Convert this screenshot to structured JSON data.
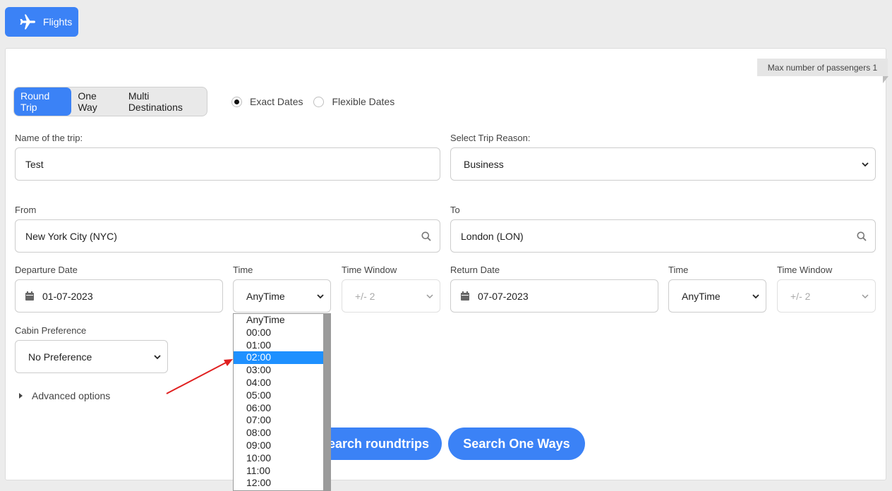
{
  "nav": {
    "flights_label": "Flights"
  },
  "badge": {
    "max_passengers": "Max number of passengers 1"
  },
  "trip_types": [
    "Round Trip",
    "One Way",
    "Multi Destinations"
  ],
  "date_modes": [
    "Exact Dates",
    "Flexible Dates"
  ],
  "form": {
    "trip_name_label": "Name of the trip:",
    "trip_name_value": "Test",
    "reason_label": "Select Trip Reason:",
    "reason_value": "Business",
    "from_label": "From",
    "from_value": "New York City (NYC)",
    "to_label": "To",
    "to_value": "London (LON)",
    "departure_label": "Departure Date",
    "departure_value": "01-07-2023",
    "dep_time_label": "Time",
    "dep_time_value": "AnyTime",
    "dep_window_label": "Time Window",
    "dep_window_value": "+/- 2",
    "return_label": "Return Date",
    "return_value": "07-07-2023",
    "ret_time_label": "Time",
    "ret_time_value": "AnyTime",
    "ret_window_label": "Time Window",
    "ret_window_value": "+/- 2",
    "cabin_label": "Cabin Preference",
    "cabin_value": "No Preference",
    "advanced_label": "Advanced options"
  },
  "buttons": {
    "search_roundtrips": "Search roundtrips",
    "search_oneways": "Search One Ways"
  },
  "time_dropdown": {
    "options": [
      "AnyTime",
      "00:00",
      "01:00",
      "02:00",
      "03:00",
      "04:00",
      "05:00",
      "06:00",
      "07:00",
      "08:00",
      "09:00",
      "10:00",
      "11:00",
      "12:00"
    ],
    "highlighted": "02:00"
  },
  "colors": {
    "accent": "#3b82f6",
    "highlight": "#1e90ff",
    "annotation": "#e02020"
  }
}
